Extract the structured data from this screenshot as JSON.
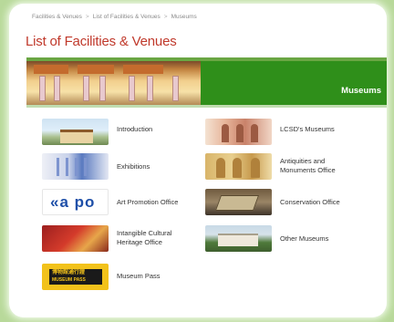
{
  "breadcrumb": {
    "items": [
      "Facilities & Venues",
      "List of Facilities & Venues",
      "Museums"
    ],
    "separator": ">"
  },
  "page_title": "List of Facilities & Venues",
  "banner": {
    "label": "Museums"
  },
  "left_column": [
    {
      "label": "Introduction",
      "icon": "intro-thumbnail"
    },
    {
      "label": "Exhibitions",
      "icon": "exhibitions-thumbnail"
    },
    {
      "label": "Art Promotion Office",
      "icon": "apo-logo-thumbnail",
      "logo_text": "«a po"
    },
    {
      "label": "Intangible Cultural Heritage Office",
      "icon": "heritage-thumbnail"
    },
    {
      "label": "Museum Pass",
      "icon": "museum-pass-thumbnail",
      "logo_cn": "博物館通行證",
      "logo_en": "MUSEUM PASS"
    }
  ],
  "right_column": [
    {
      "label": "LCSD's Museums",
      "icon": "lcsd-museums-thumbnail"
    },
    {
      "label": "Antiquities and Monuments Office",
      "icon": "antiquities-thumbnail"
    },
    {
      "label": "Conservation Office",
      "icon": "conservation-thumbnail"
    },
    {
      "label": "Other Museums",
      "icon": "other-museums-thumbnail"
    }
  ],
  "colors": {
    "title_red": "#c0392b",
    "banner_green": "#2f8f1a",
    "page_bg_green": "#b8d99a",
    "museum_pass_yellow": "#f2c21b",
    "apo_blue": "#1e4fa8"
  }
}
